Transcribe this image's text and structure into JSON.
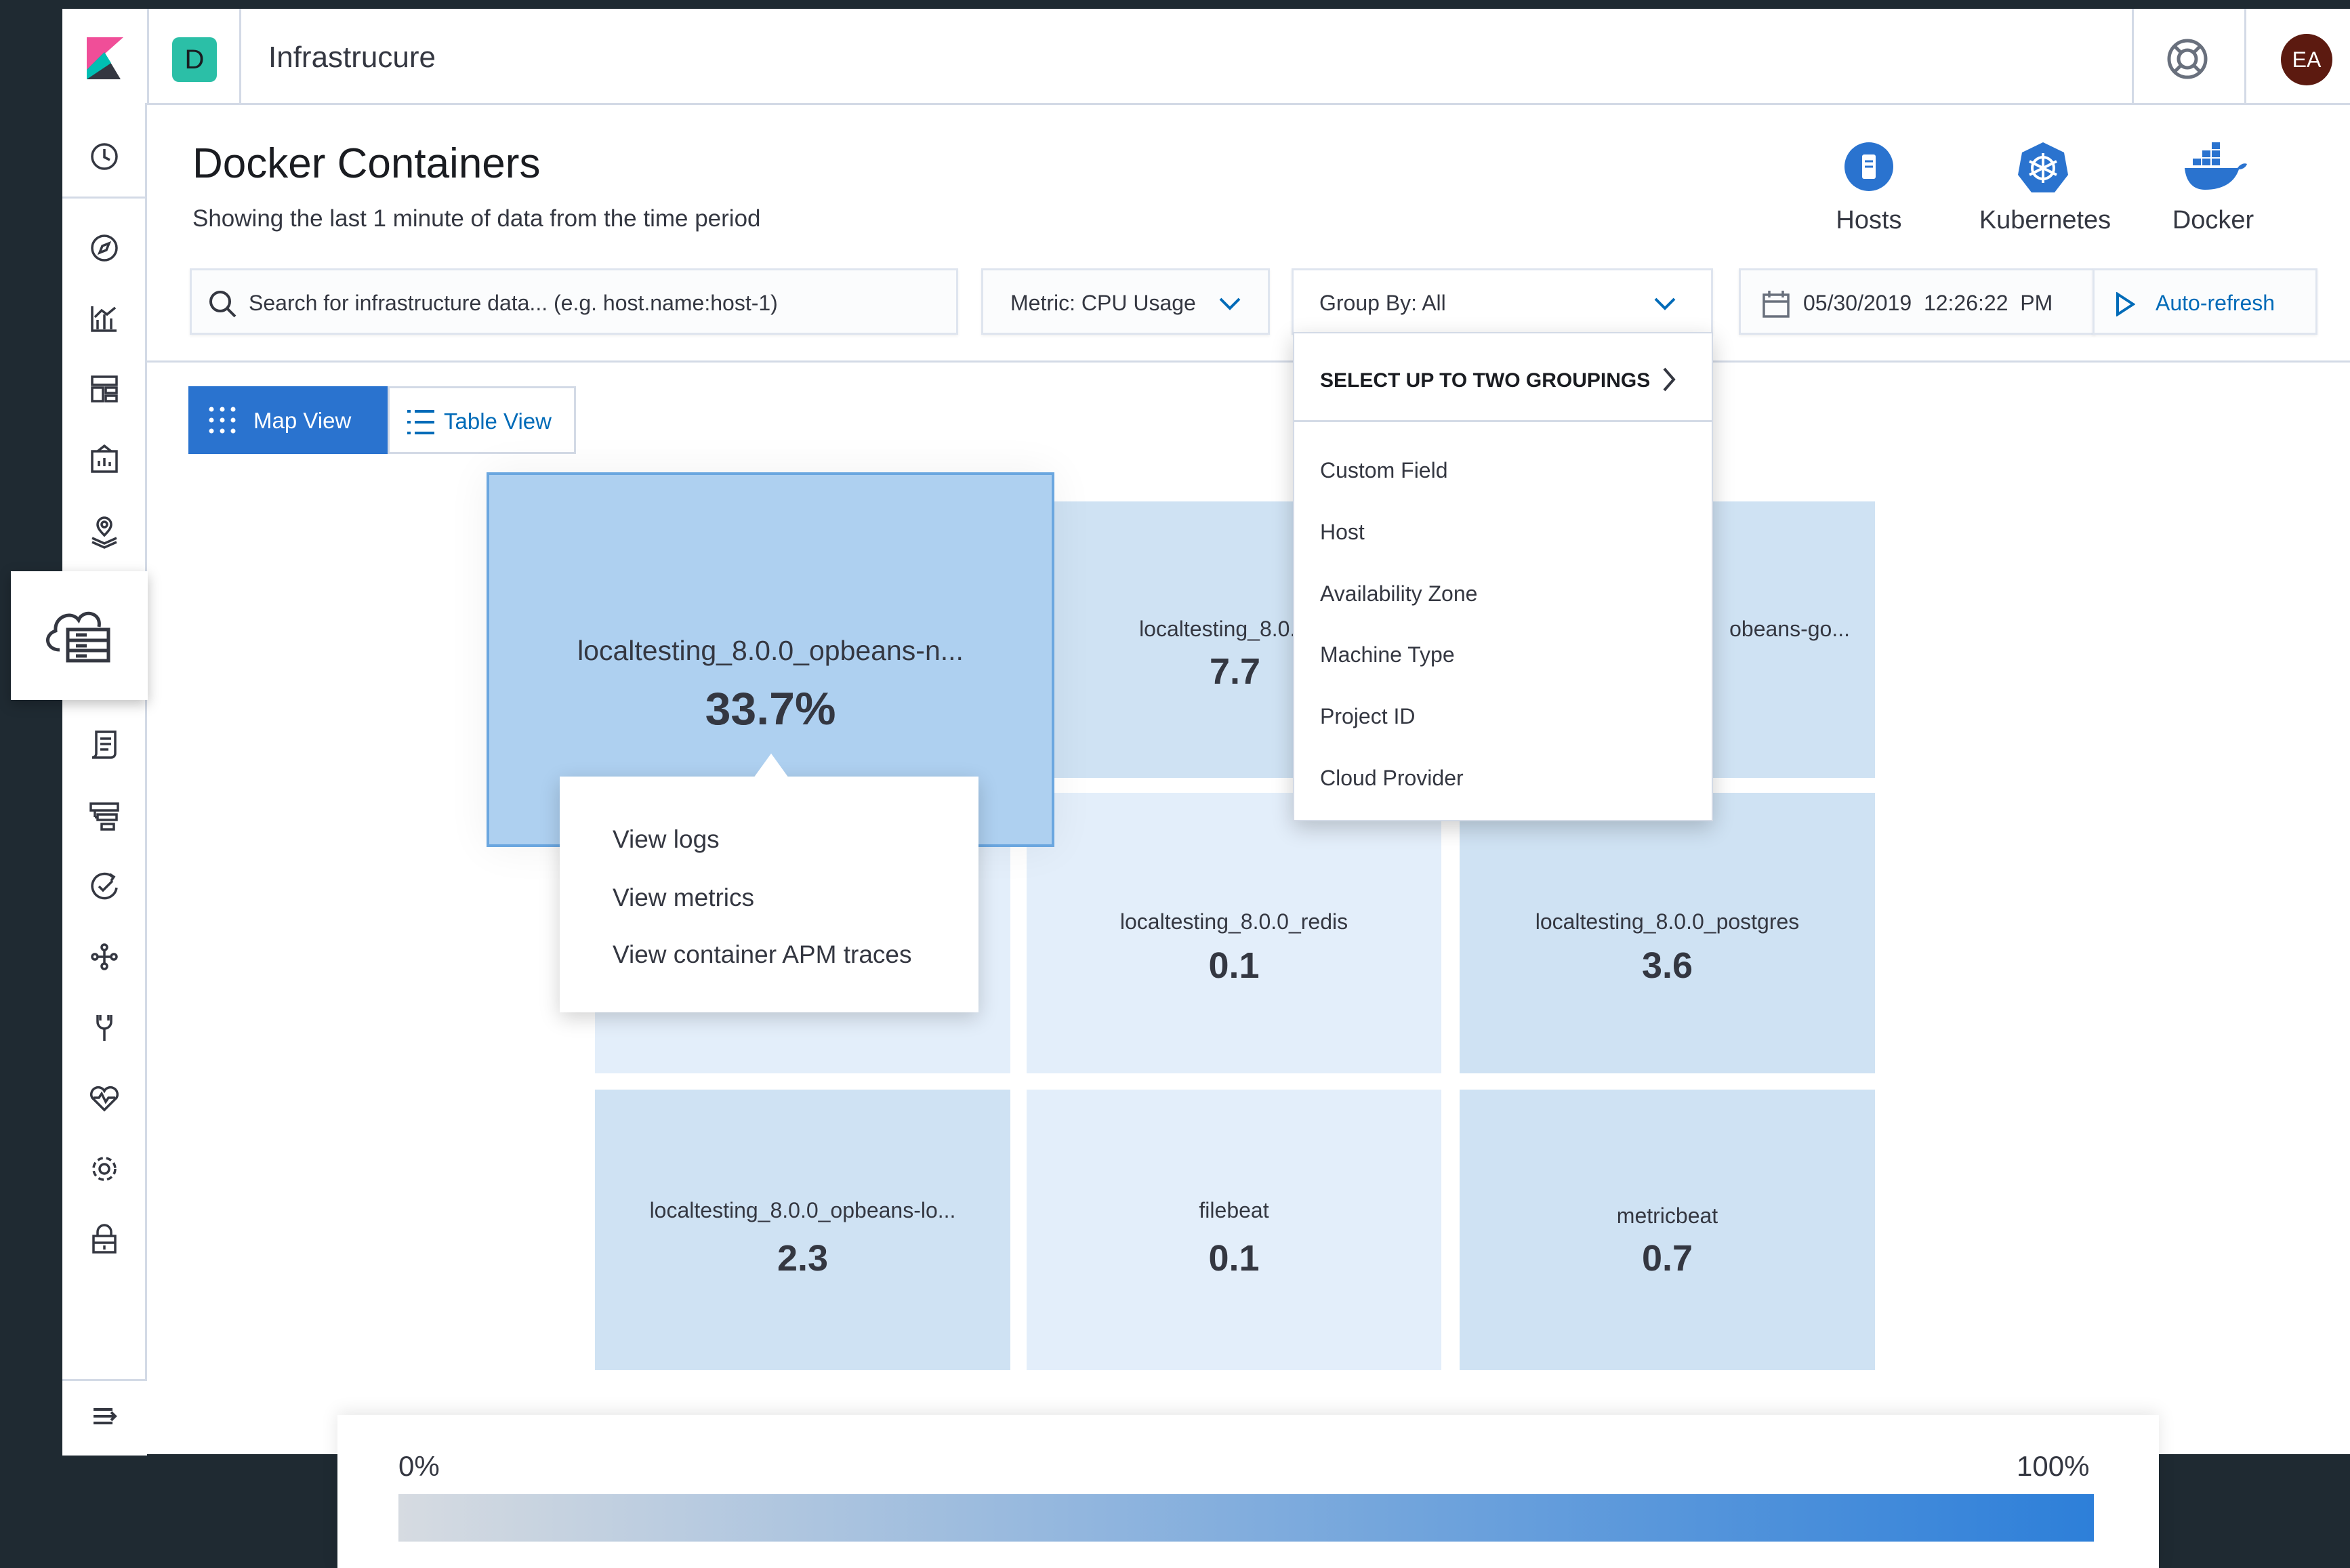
{
  "header": {
    "app_badge": "D",
    "app_title": "Infrastrucure",
    "avatar_initials": "EA"
  },
  "page": {
    "title": "Docker Containers",
    "subtitle": "Showing the last 1 minute of data from the time period"
  },
  "inventory_types": [
    {
      "label": "Hosts",
      "icon": "server-icon"
    },
    {
      "label": "Kubernetes",
      "icon": "kubernetes-icon"
    },
    {
      "label": "Docker",
      "icon": "docker-icon"
    }
  ],
  "toolbar": {
    "search_placeholder": "Search for infrastructure data... (e.g. host.name:host-1)",
    "metric_label": "Metric: CPU Usage",
    "group_by_label": "Group By: All",
    "date_time": "05/30/2019  12:26:22  PM",
    "auto_refresh_label": "Auto-refresh"
  },
  "view_toggle": {
    "map_label": "Map View",
    "table_label": "Table View",
    "active": "map"
  },
  "group_dropdown": {
    "header": "SELECT UP TO TWO GROUPINGS",
    "options": [
      "Custom Field",
      "Host",
      "Availability Zone",
      "Machine Type",
      "Project ID",
      "Cloud Provider"
    ]
  },
  "tiles": [
    {
      "name": "localtesting_8.0.0_opbeans-n...",
      "value": "33.7%"
    },
    {
      "name": "localtesting_8.0.0_c",
      "value": "7.7"
    },
    {
      "name": "obeans-go...",
      "value": ""
    },
    {
      "name": "localtesting_8.0.0_redis",
      "value": "0.1"
    },
    {
      "name": "localtesting_8.0.0_postgres",
      "value": "3.6"
    },
    {
      "name": "localtesting_8.0.0_opbeans-lo...",
      "value": "2.3"
    },
    {
      "name": "filebeat",
      "value": "0.1"
    },
    {
      "name": "metricbeat",
      "value": "0.7"
    }
  ],
  "context_menu": {
    "items": [
      "View logs",
      "View metrics",
      "View container APM traces"
    ]
  },
  "legend": {
    "min_label": "0%",
    "max_label": "100%"
  },
  "colors": {
    "accent": "#2a73cf",
    "tile_selected": "#aed0f0",
    "tile_light": "#e3eefa",
    "tile_mid": "#cfe2f3"
  }
}
